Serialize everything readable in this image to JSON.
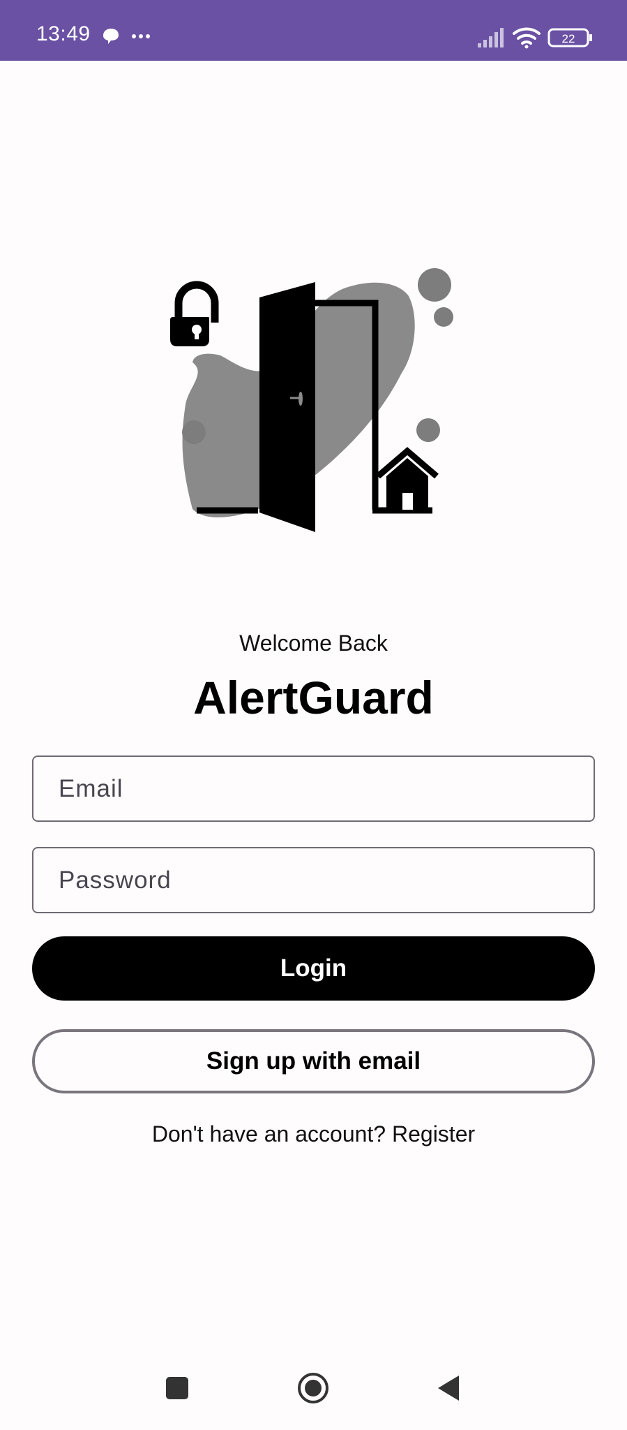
{
  "status_bar": {
    "time": "13:49",
    "left_icons": [
      "chat-bubble-icon",
      "more-dots-icon"
    ],
    "right_icons": [
      "signal-icon",
      "wifi-icon",
      "battery-icon"
    ],
    "battery_level": "22",
    "background_color": "#6a51a3"
  },
  "header": {
    "welcome": "Welcome Back",
    "title": "AlertGuard"
  },
  "form": {
    "email_placeholder": "Email",
    "email_value": "",
    "password_placeholder": "Password",
    "password_value": ""
  },
  "buttons": {
    "login_label": "Login",
    "signup_label": "Sign up with email"
  },
  "footer": {
    "prompt": "Don't have an account?",
    "register_label": "Register"
  },
  "nav_bar": {
    "icons": [
      "recents-square-icon",
      "home-circle-icon",
      "back-triangle-icon"
    ]
  },
  "colors": {
    "accent": "#6a51a3",
    "primary_button": "#000000",
    "outline": "#79747e",
    "background": "#fffcfd"
  }
}
